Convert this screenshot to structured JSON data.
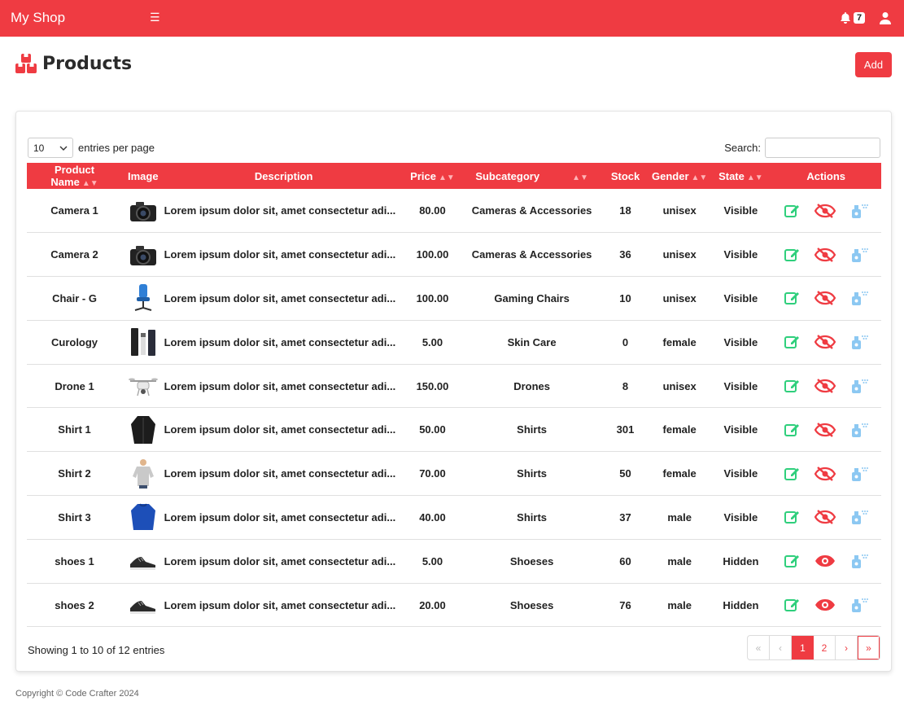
{
  "header": {
    "brand": "My Shop",
    "notification_count": "7",
    "accent": "#ef3b42"
  },
  "page": {
    "title": "Products",
    "add_label": "Add"
  },
  "controls": {
    "page_length": "10",
    "entries_label": "entries per page",
    "search_label": "Search:"
  },
  "table": {
    "columns": [
      "Product Name",
      "Image",
      "Description",
      "Price",
      "Subcategory",
      "Stock",
      "Gender",
      "State",
      "Actions"
    ],
    "rows": [
      {
        "name": "Camera 1",
        "image": "camera-icon",
        "desc": "Lorem ipsum dolor sit, amet consectetur adi...",
        "price": "80.00",
        "subcategory": "Cameras & Accessories",
        "stock": "18",
        "gender": "unisex",
        "state": "Visible"
      },
      {
        "name": "Camera 2",
        "image": "camera-icon",
        "desc": "Lorem ipsum dolor sit, amet consectetur adi...",
        "price": "100.00",
        "subcategory": "Cameras & Accessories",
        "stock": "36",
        "gender": "unisex",
        "state": "Visible"
      },
      {
        "name": "Chair - G",
        "image": "chair-icon",
        "desc": "Lorem ipsum dolor sit, amet consectetur adi...",
        "price": "100.00",
        "subcategory": "Gaming Chairs",
        "stock": "10",
        "gender": "unisex",
        "state": "Visible"
      },
      {
        "name": "Curology",
        "image": "bottles-icon",
        "desc": "Lorem ipsum dolor sit, amet consectetur adi...",
        "price": "5.00",
        "subcategory": "Skin Care",
        "stock": "0",
        "gender": "female",
        "state": "Visible"
      },
      {
        "name": "Drone 1",
        "image": "drone-icon",
        "desc": "Lorem ipsum dolor sit, amet consectetur adi...",
        "price": "150.00",
        "subcategory": "Drones",
        "stock": "8",
        "gender": "unisex",
        "state": "Visible"
      },
      {
        "name": "Shirt 1",
        "image": "jacket-icon",
        "desc": "Lorem ipsum dolor sit, amet consectetur adi...",
        "price": "50.00",
        "subcategory": "Shirts",
        "stock": "301",
        "gender": "female",
        "state": "Visible"
      },
      {
        "name": "Shirt 2",
        "image": "sweater-icon",
        "desc": "Lorem ipsum dolor sit, amet consectetur adi...",
        "price": "70.00",
        "subcategory": "Shirts",
        "stock": "50",
        "gender": "female",
        "state": "Visible"
      },
      {
        "name": "Shirt 3",
        "image": "sweater-blue-icon",
        "desc": "Lorem ipsum dolor sit, amet consectetur adi...",
        "price": "40.00",
        "subcategory": "Shirts",
        "stock": "37",
        "gender": "male",
        "state": "Visible"
      },
      {
        "name": "shoes 1",
        "image": "shoe-icon",
        "desc": "Lorem ipsum dolor sit, amet consectetur adi...",
        "price": "5.00",
        "subcategory": "Shoeses",
        "stock": "60",
        "gender": "male",
        "state": "Hidden"
      },
      {
        "name": "shoes 2",
        "image": "shoe-icon",
        "desc": "Lorem ipsum dolor sit, amet consectetur adi...",
        "price": "20.00",
        "subcategory": "Shoeses",
        "stock": "76",
        "gender": "male",
        "state": "Hidden"
      }
    ]
  },
  "pagination": {
    "info": "Showing 1 to 10 of 12 entries",
    "first": "«",
    "prev": "‹",
    "pages": [
      "1",
      "2"
    ],
    "active": "1",
    "next": "›",
    "last": "»"
  },
  "footer": {
    "copyright": "Copyright © Code Crafter 2024"
  }
}
